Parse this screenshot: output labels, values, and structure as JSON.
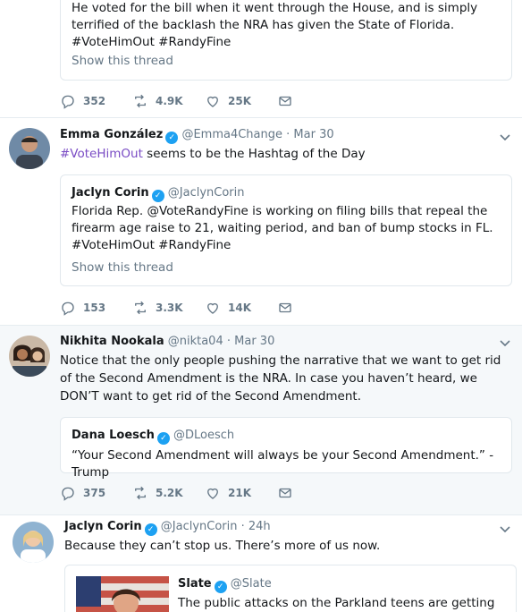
{
  "tweets": [
    {
      "quote": {
        "text": "He voted for the bill when it went through the House, and is simply terrified of the backlash the NRA has given the State of Florida. #VoteHimOut #RandyFine",
        "show_thread": "Show this thread"
      },
      "stats": {
        "replies": "352",
        "retweets": "4.9K",
        "likes": "25K"
      }
    },
    {
      "name": "Emma González",
      "handle": "@Emma4Change",
      "time": "· Mar 30",
      "text_hashtag": "#VoteHimOut",
      "text_rest": " seems to be the Hashtag of the Day",
      "quote": {
        "name": "Jaclyn Corin",
        "handle": "@JaclynCorin",
        "text": "Florida Rep. @VoteRandyFine is working on filing bills that repeal the firearm age raise to 21, waiting period, and ban of bump stocks in FL. #VoteHimOut #RandyFine",
        "show_thread": "Show this thread"
      },
      "stats": {
        "replies": "153",
        "retweets": "3.3K",
        "likes": "14K"
      }
    },
    {
      "name": "Nikhita Nookala",
      "handle": "@nikta04",
      "time": "· Mar 30",
      "text": "Notice that the only people pushing the narrative that we want to get rid of the Second Amendment is the NRA. In case you haven’t heard, we DON’T want to get rid of the Second Amendment.",
      "quote": {
        "name": "Dana Loesch",
        "handle": "@DLoesch",
        "text": "“Your Second Amendment will always be your Second Amendment.” - Trump"
      },
      "stats": {
        "replies": "375",
        "retweets": "5.2K",
        "likes": "21K"
      }
    },
    {
      "name": "Jaclyn Corin",
      "handle": "@JaclynCorin",
      "time": "· 24h",
      "text": "Because they can’t stop us. There’s more of us now.",
      "quote": {
        "name": "Slate",
        "handle": "@Slate",
        "text": "The public attacks on the Parkland teens are getting"
      }
    }
  ],
  "colors": {
    "accent": "#1da1f2",
    "hashtag": "#794bc4",
    "muted": "#657786",
    "border": "#e1e8ed"
  },
  "icons": [
    "reply-icon",
    "retweet-icon",
    "like-icon",
    "message-icon",
    "verified-icon",
    "chevron-down-icon"
  ]
}
